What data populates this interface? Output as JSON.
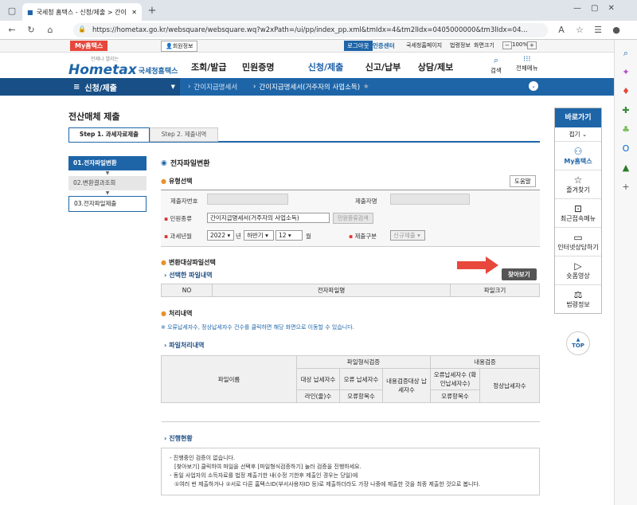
{
  "browser": {
    "tab_title": "국세청 홈택스 - 신청/제출 > 간이",
    "url": "https://hometax.go.kr/websquare/websquare.wq?w2xPath=/ui/pp/index_pp.xml&tmIdx=4&tm2lIdx=0405000000&tm3lIdx=04...",
    "zoom": "100%"
  },
  "util": {
    "my_hometax": "My홈택스",
    "member_info": "회원정보",
    "logout": "로그아웃",
    "cert_center": "인증센터",
    "nts_home": "국세청홈페이지",
    "law_info": "법령정보",
    "screen_size": "화면크기"
  },
  "header": {
    "logo_text": "Hometax",
    "logo_sub": "국세청홈택스",
    "logo_tag": "언제나 열리는",
    "menus": [
      "조회/발급",
      "민원증명",
      "신청/제출",
      "신고/납부",
      "상담/제보"
    ],
    "search": "검색",
    "all_menu": "전체메뉴"
  },
  "nav2": {
    "section": "신청/제출",
    "crumb1": "간이지급명세서",
    "crumb2": "간이지급명세서(거주자의 사업소득)"
  },
  "page": {
    "title": "전산매체 제출",
    "tabs": [
      "Step 1. 과세자료제출",
      "Step 2. 제출내역"
    ],
    "steps": [
      "01.전자파일변환",
      "02.변환결과조회",
      "03.전자파일제출"
    ],
    "section_title": "전자파일변환",
    "type_select": "유형선택",
    "help": "도움말",
    "submitter_no": "제출자번호",
    "submitter_name": "제출자명",
    "civil_type": "민원종류",
    "civil_type_value": "간이지급명세서(거주자의 사업소득)",
    "civil_search_btn": "민원종류검색",
    "tax_year": "과세년월",
    "year_value": "2022",
    "year_unit": "년",
    "half_value": "하반기",
    "month_value": "12",
    "month_unit": "월",
    "submit_type": "제출구분",
    "submit_type_value": "신규제출",
    "convert_file_select": "변환대상파일선택",
    "selected_file_list": "선택한 파일내역",
    "browse_btn": "찾아보기",
    "file_table_headers": [
      "NO",
      "전자파일명",
      "파일크기"
    ],
    "process_title": "처리내역",
    "process_note": "※ 오류납세자수, 정상납세자수 건수를 클릭하면 해당 화면으로 이동할 수 있습니다.",
    "file_process_list": "파일처리내역",
    "proc_headers": {
      "file_name": "파일이름",
      "format_check": "파일형식검증",
      "content_check": "내용검증",
      "target_taxpayers": "대상 납세자수",
      "error_taxpayers": "오류 납세자수",
      "content_target": "내용검증대상 납세자수",
      "error_confirmed": "오류납세자수 (확인납세자수)",
      "normal_taxpayers": "정상납세자수",
      "lines": "라인(줄)수",
      "error_items": "오류항목수",
      "error_items2": "오류항목수"
    },
    "progress_title": "진행현황",
    "progress_lines": [
      "- 진행중인 검증이 없습니다.",
      "[찾아보기] 클릭하여 파일을 선택후 [파일형식검증하기] 눌러 검증을 진행하세요.",
      "- 동일 사업자의 소득자료를 법정 제출기한 내(수정 기한후 제출인 경우는 당일)에",
      "①여러 번 제출하거나 ②서로 다른 홈택스ID(부서사용자ID 등)로 제출하더라도 가장 나중에 제출한 것을 최종 제출한 것으로 봅니다."
    ]
  },
  "quick": {
    "title": "바로가기",
    "fold": "접기",
    "items": [
      "My홈택스",
      "즐겨찾기",
      "최근접속메뉴",
      "인터넷상담하기",
      "숏폼영상",
      "법령정보"
    ],
    "top": "TOP"
  },
  "colors": {
    "primary": "#1e65a8",
    "accent": "#e8473c",
    "nav_dark": "#174f86"
  }
}
